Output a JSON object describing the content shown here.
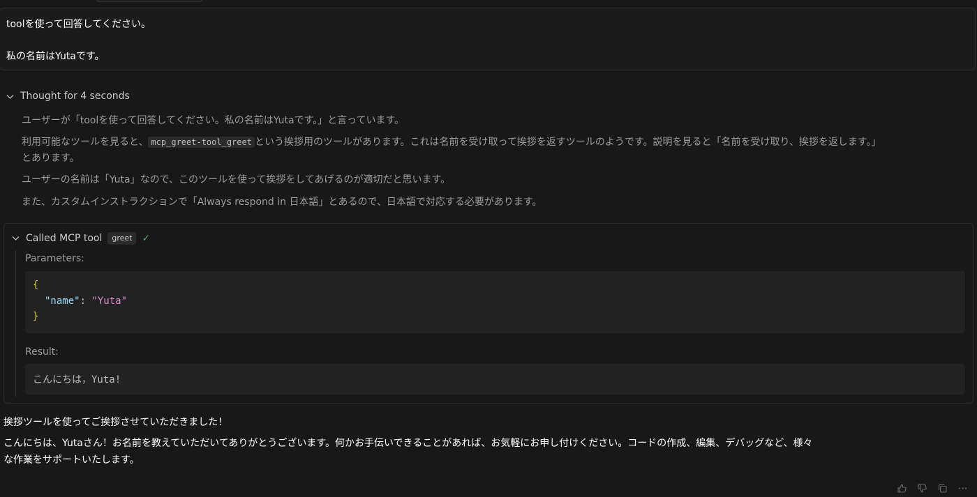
{
  "user_message": {
    "line1": "toolを使って回答してください。",
    "line2": "私の名前はYutaです。"
  },
  "thought": {
    "title": "Thought for 4 seconds",
    "line1": "ユーザーが「toolを使って回答してください。私の名前はYutaです。」と言っています。",
    "line2_before": "利用可能なツールを見ると、",
    "line2_code": "mcp_greet-tool_greet",
    "line2_after": "という挨拶用のツールがあります。これは名前を受け取って挨拶を返すツールのようです。説明を見ると「名前を受け取り、挨拶を返します。」",
    "line2_wrap": "とあります。",
    "line3": "ユーザーの名前は「Yuta」なので、このツールを使って挨拶をしてあげるのが適切だと思います。",
    "line4": "また、カスタムインストラクションで「Always respond in 日本語」とあるので、日本語で対応する必要があります。"
  },
  "tool_call": {
    "title": "Called MCP tool",
    "tool_name": "greet",
    "status_icon": "check-icon",
    "parameters_label": "Parameters:",
    "code": {
      "open_brace": "{",
      "key": "\"name\"",
      "colon": ": ",
      "value": "\"Yuta\"",
      "close_brace": "}"
    },
    "result_label": "Result:",
    "result_text": "こんにちは，Yuta!"
  },
  "assistant_reply": {
    "line1": "挨拶ツールを使ってご挨拶させていただきました！",
    "line2": "こんにちは、Yutaさん！お名前を教えていただいてありがとうございます。何かお手伝いできることがあれば、お気軽にお申し付けください。コードの作成、編集、デバッグなど、様々",
    "line3": "な作業をサポートいたします。"
  },
  "actions": {
    "icons": [
      "thumbs-up-icon",
      "thumbs-down-icon",
      "copy-icon",
      "more-icon"
    ]
  },
  "colors": {
    "background": "#181818",
    "success": "#4ea96b",
    "json_brace": "#f2cc30",
    "json_key": "#9cdcfe",
    "json_string": "#e08ed1"
  }
}
